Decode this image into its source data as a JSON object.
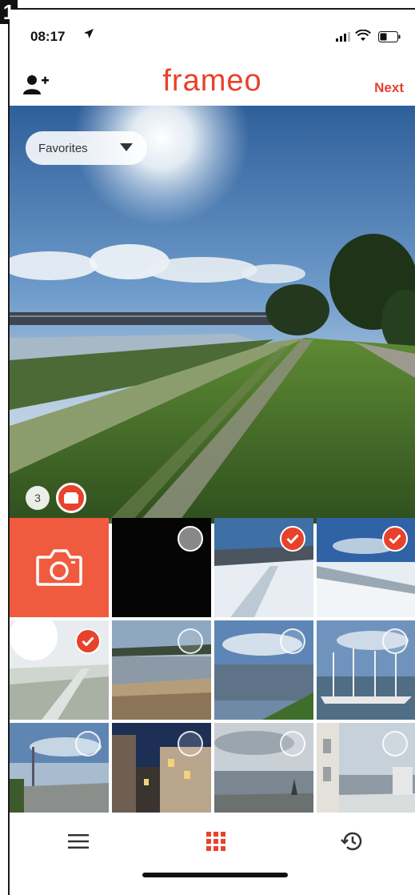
{
  "step_number": "1",
  "status_bar": {
    "time": "08:17"
  },
  "header": {
    "app_name": "frameo",
    "next_label": "Next"
  },
  "hero": {
    "album_label": "Favorites",
    "selected_count": "3"
  },
  "grid": {
    "cells": [
      {
        "kind": "camera",
        "selected": false
      },
      {
        "kind": "photo",
        "scene": "dark",
        "selected": false
      },
      {
        "kind": "photo",
        "scene": "snow",
        "selected": true
      },
      {
        "kind": "photo",
        "scene": "snow-sky",
        "selected": true
      },
      {
        "kind": "photo",
        "scene": "beach-bright",
        "selected": true
      },
      {
        "kind": "photo",
        "scene": "riverbank",
        "selected": false
      },
      {
        "kind": "photo",
        "scene": "lake",
        "selected": false
      },
      {
        "kind": "photo",
        "scene": "harbor",
        "selected": false
      },
      {
        "kind": "photo",
        "scene": "promenade",
        "selected": false
      },
      {
        "kind": "photo",
        "scene": "town-night",
        "selected": false
      },
      {
        "kind": "photo",
        "scene": "grey-sea",
        "selected": false
      },
      {
        "kind": "photo",
        "scene": "building-water",
        "selected": false
      }
    ]
  },
  "tabbar": {
    "active": "gallery"
  },
  "colors": {
    "accent": "#e8412c",
    "camera_tile": "#f05a3f"
  }
}
